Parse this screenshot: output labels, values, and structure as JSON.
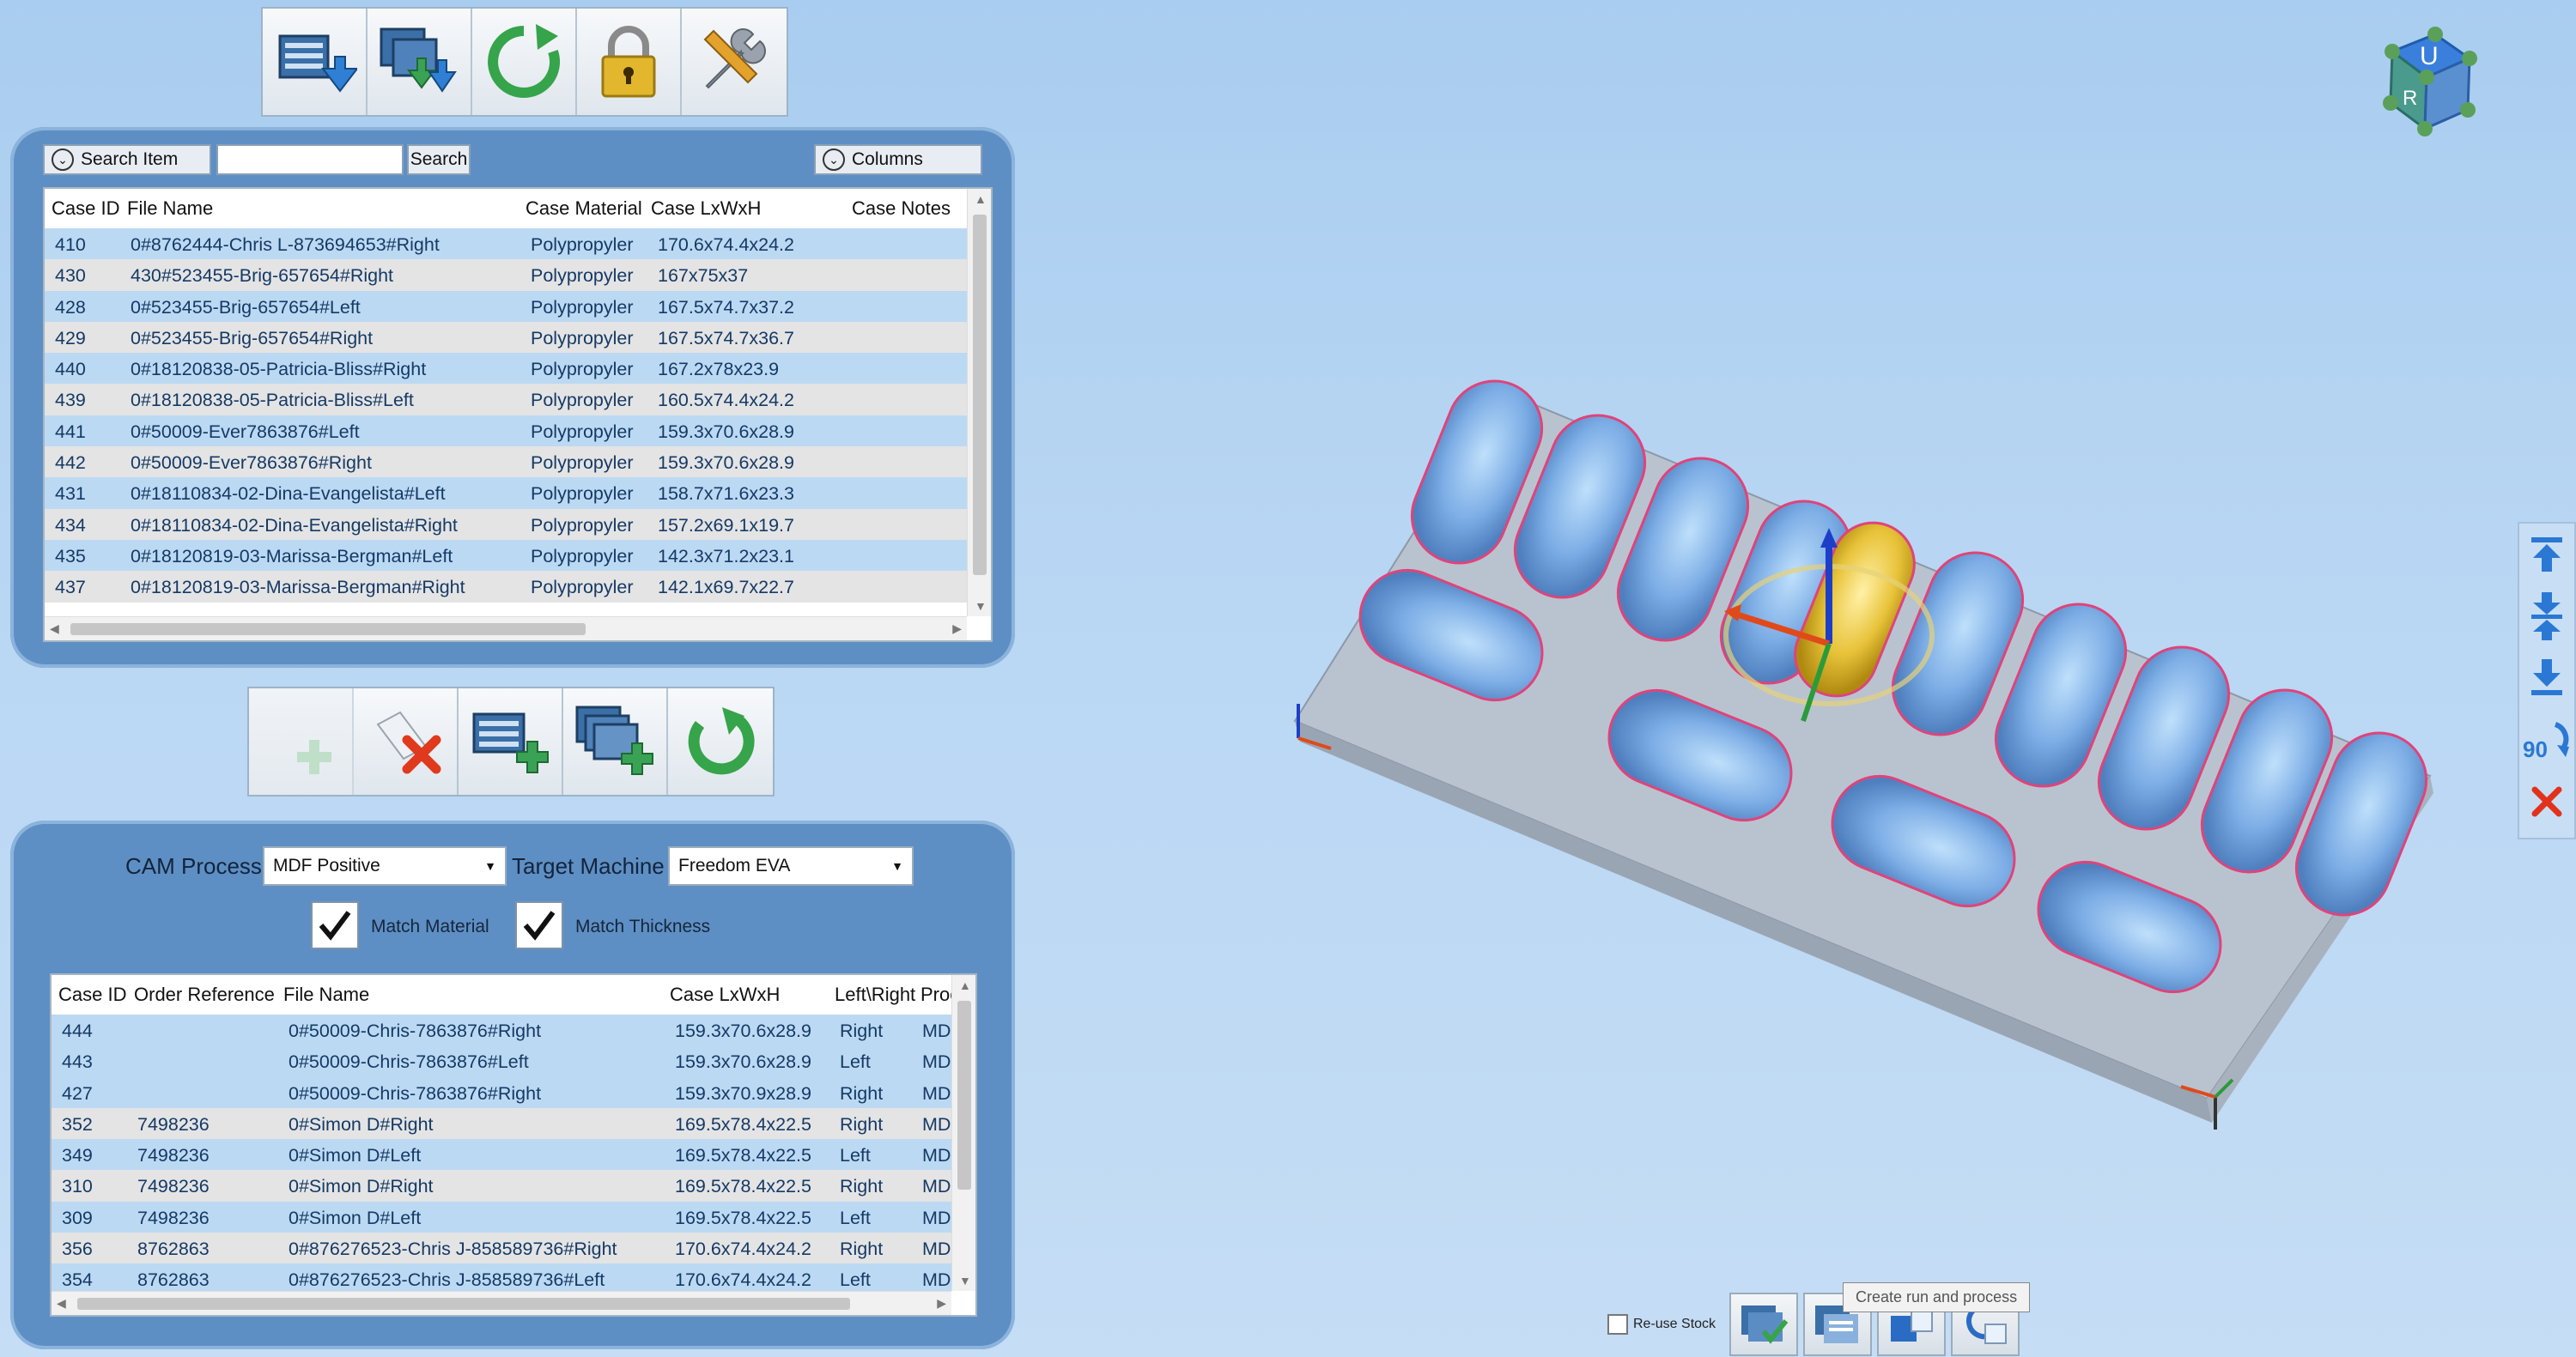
{
  "top_toolbar": {
    "buttons": [
      {
        "name": "import-case-icon"
      },
      {
        "name": "batch-import-icon"
      },
      {
        "name": "refresh-icon"
      },
      {
        "name": "lock-icon"
      },
      {
        "name": "tools-icon"
      }
    ]
  },
  "case_panel": {
    "search_item_label": "Search Item",
    "search_value": "",
    "search_button": "Search",
    "columns_label": "Columns",
    "headers": [
      "Case ID",
      "File Name",
      "Case Material",
      "Case LxWxH",
      "Case Notes"
    ],
    "rows": [
      {
        "id": "410",
        "file": "0#8762444-Chris L-873694653#Right",
        "material": "Polypropyler",
        "size": "170.6x74.4x24.2"
      },
      {
        "id": "430",
        "file": "430#523455-Brig-657654#Right",
        "material": "Polypropyler",
        "size": "167x75x37"
      },
      {
        "id": "428",
        "file": "0#523455-Brig-657654#Left",
        "material": "Polypropyler",
        "size": "167.5x74.7x37.2"
      },
      {
        "id": "429",
        "file": "0#523455-Brig-657654#Right",
        "material": "Polypropyler",
        "size": "167.5x74.7x36.7"
      },
      {
        "id": "440",
        "file": "0#18120838-05-Patricia-Bliss#Right",
        "material": "Polypropyler",
        "size": "167.2x78x23.9"
      },
      {
        "id": "439",
        "file": "0#18120838-05-Patricia-Bliss#Left",
        "material": "Polypropyler",
        "size": "160.5x74.4x24.2"
      },
      {
        "id": "441",
        "file": "0#50009-Ever7863876#Left",
        "material": "Polypropyler",
        "size": "159.3x70.6x28.9"
      },
      {
        "id": "442",
        "file": "0#50009-Ever7863876#Right",
        "material": "Polypropyler",
        "size": "159.3x70.6x28.9"
      },
      {
        "id": "431",
        "file": "0#18110834-02-Dina-Evangelista#Left",
        "material": "Polypropyler",
        "size": "158.7x71.6x23.3"
      },
      {
        "id": "434",
        "file": "0#18110834-02-Dina-Evangelista#Right",
        "material": "Polypropyler",
        "size": "157.2x69.1x19.7"
      },
      {
        "id": "435",
        "file": "0#18120819-03-Marissa-Bergman#Left",
        "material": "Polypropyler",
        "size": "142.3x71.2x23.1"
      },
      {
        "id": "437",
        "file": "0#18120819-03-Marissa-Bergman#Right",
        "material": "Polypropyler",
        "size": "142.1x69.7x22.7"
      }
    ]
  },
  "mid_toolbar": {
    "buttons": [
      {
        "name": "add-disabled-icon"
      },
      {
        "name": "remove-icon"
      },
      {
        "name": "add-case-icon"
      },
      {
        "name": "add-multiple-icon"
      },
      {
        "name": "undo-icon"
      }
    ]
  },
  "cam_panel": {
    "cam_process_label": "CAM Process",
    "cam_process_value": "MDF Positive",
    "target_machine_label": "Target Machine",
    "target_machine_value": "Freedom EVA",
    "match_material_label": "Match Material",
    "match_material_checked": true,
    "match_thickness_label": "Match Thickness",
    "match_thickness_checked": true,
    "headers": [
      "Case ID",
      "Order Reference",
      "File Name",
      "Case LxWxH",
      "Left\\Right",
      "Proc"
    ],
    "rows": [
      {
        "id": "444",
        "order": "",
        "file": "0#50009-Chris-7863876#Right",
        "size": "159.3x70.6x28.9",
        "side": "Right",
        "proc": "MD"
      },
      {
        "id": "443",
        "order": "",
        "file": "0#50009-Chris-7863876#Left",
        "size": "159.3x70.6x28.9",
        "side": "Left",
        "proc": "MD"
      },
      {
        "id": "427",
        "order": "",
        "file": "0#50009-Chris-7863876#Right",
        "size": "159.3x70.9x28.9",
        "side": "Right",
        "proc": "MD"
      },
      {
        "id": "352",
        "order": "7498236",
        "file": "0#Simon D#Right",
        "size": "169.5x78.4x22.5",
        "side": "Right",
        "proc": "MD"
      },
      {
        "id": "349",
        "order": "7498236",
        "file": "0#Simon D#Left",
        "size": "169.5x78.4x22.5",
        "side": "Left",
        "proc": "MD"
      },
      {
        "id": "310",
        "order": "7498236",
        "file": "0#Simon D#Right",
        "size": "169.5x78.4x22.5",
        "side": "Right",
        "proc": "MD"
      },
      {
        "id": "309",
        "order": "7498236",
        "file": "0#Simon D#Left",
        "size": "169.5x78.4x22.5",
        "side": "Left",
        "proc": "MD"
      },
      {
        "id": "356",
        "order": "8762863",
        "file": "0#876276523-Chris J-858589736#Right",
        "size": "170.6x74.4x24.2",
        "side": "Right",
        "proc": "MD"
      },
      {
        "id": "354",
        "order": "8762863",
        "file": "0#876276523-Chris J-858589736#Left",
        "size": "170.6x74.4x24.2",
        "side": "Left",
        "proc": "MD"
      }
    ]
  },
  "nav_cube": {
    "top_face": "U",
    "front_face": "R"
  },
  "right_toolbar": {
    "rotate_label": "90",
    "buttons": [
      {
        "name": "move-to-top-icon"
      },
      {
        "name": "center-vertical-icon"
      },
      {
        "name": "move-to-bottom-icon"
      },
      {
        "name": "rotate-90-icon"
      },
      {
        "name": "delete-icon"
      }
    ]
  },
  "bottom_bar": {
    "reuse_stock_label": "Re-use Stock",
    "reuse_stock_checked": false,
    "tooltip": "Create run and process"
  },
  "colors": {
    "panel": "#5d8fc5",
    "row_selected": "#bcd9f3",
    "row_alt": "#e4e4e4",
    "stock_plate": "#b9c3cf",
    "insole": "#7eaee6",
    "selected_insole": "#e8c33a"
  }
}
